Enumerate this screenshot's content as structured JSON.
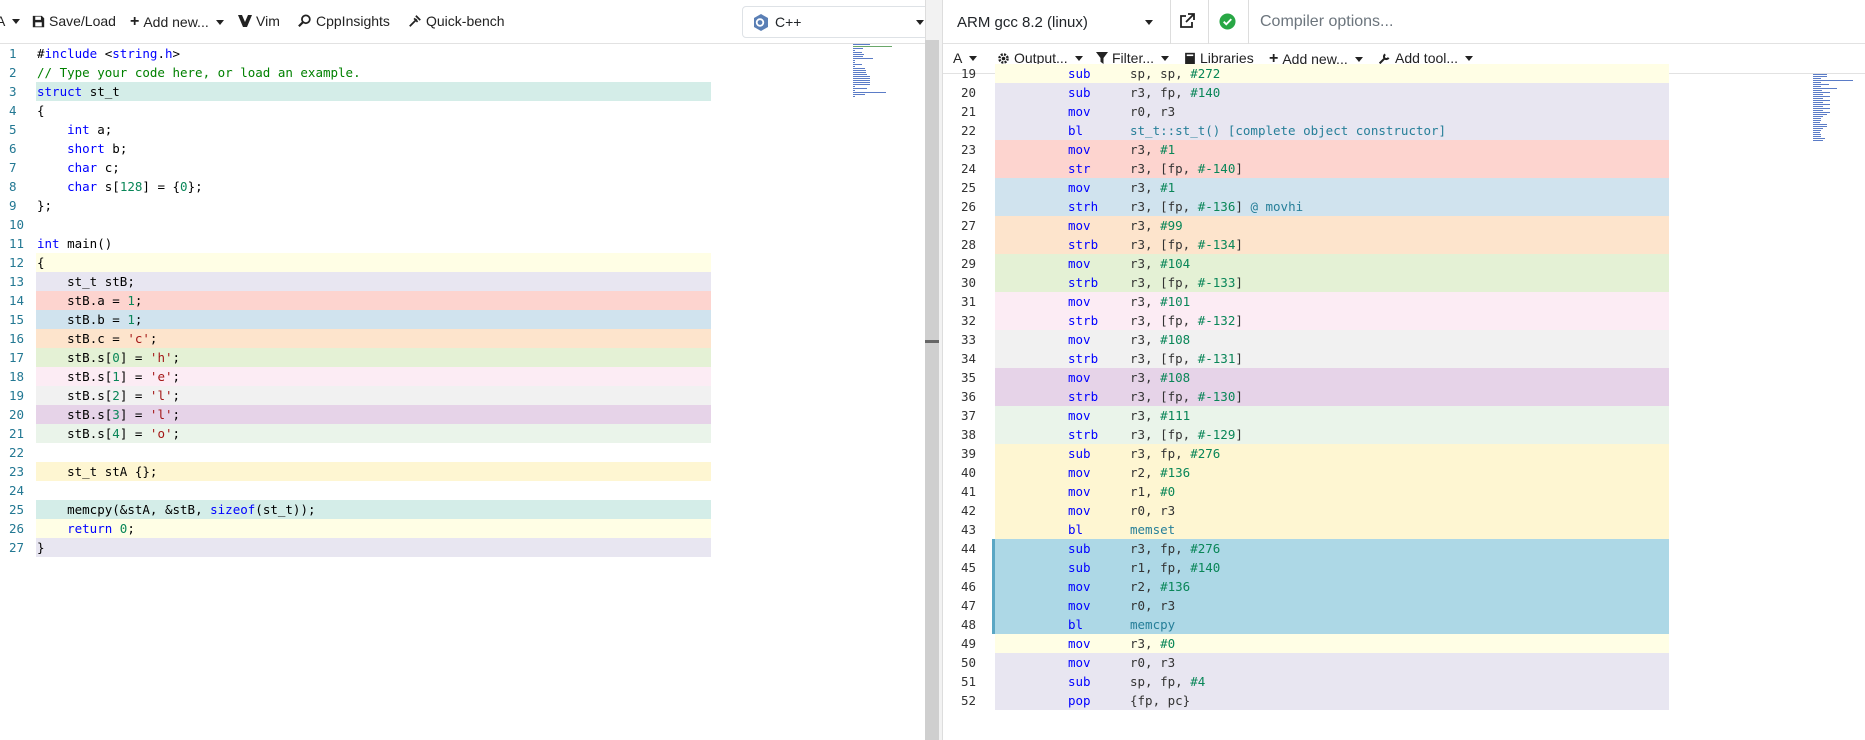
{
  "editor": {
    "toolbar": {
      "font_label": "A",
      "save_load": "Save/Load",
      "add_new": "Add new...",
      "vim": "Vim",
      "cppinsights": "CppInsights",
      "quickbench": "Quick-bench",
      "language": "C++"
    },
    "lines": [
      {
        "n": "1",
        "text": "#include <string.h>",
        "bg": ""
      },
      {
        "n": "2",
        "text": "// Type your code here, or load an example.",
        "bg": ""
      },
      {
        "n": "3",
        "text": "struct st_t",
        "bg": "#d4ede8"
      },
      {
        "n": "4",
        "text": "{",
        "bg": ""
      },
      {
        "n": "5",
        "text": "    int a;",
        "bg": ""
      },
      {
        "n": "6",
        "text": "    short b;",
        "bg": ""
      },
      {
        "n": "7",
        "text": "    char c;",
        "bg": ""
      },
      {
        "n": "8",
        "text": "    char s[128] = {0};",
        "bg": ""
      },
      {
        "n": "9",
        "text": "};",
        "bg": ""
      },
      {
        "n": "10",
        "text": "",
        "bg": ""
      },
      {
        "n": "11",
        "text": "int main()",
        "bg": ""
      },
      {
        "n": "12",
        "text": "{",
        "bg": "#fffee5"
      },
      {
        "n": "13",
        "text": "    st_t stB;",
        "bg": "#e8e6f1"
      },
      {
        "n": "14",
        "text": "    stB.a = 1;",
        "bg": "#fdd4cf"
      },
      {
        "n": "15",
        "text": "    stB.b = 1;",
        "bg": "#d0e3ee"
      },
      {
        "n": "16",
        "text": "    stB.c = 'c';",
        "bg": "#fde4cc"
      },
      {
        "n": "17",
        "text": "    stB.s[0] = 'h';",
        "bg": "#e4f1d5"
      },
      {
        "n": "18",
        "text": "    stB.s[1] = 'e';",
        "bg": "#fcecf4"
      },
      {
        "n": "19",
        "text": "    stB.s[2] = 'l';",
        "bg": "#f1f1f1"
      },
      {
        "n": "20",
        "text": "    stB.s[3] = 'l';",
        "bg": "#e6d3e8"
      },
      {
        "n": "21",
        "text": "    stB.s[4] = 'o';",
        "bg": "#eaf4ea"
      },
      {
        "n": "22",
        "text": "",
        "bg": ""
      },
      {
        "n": "23",
        "text": "    st_t stA {};",
        "bg": "#fef6d2"
      },
      {
        "n": "24",
        "text": "",
        "bg": ""
      },
      {
        "n": "25",
        "text": "    memcpy(&stA, &stB, sizeof(st_t));",
        "bg": "#d4ede8"
      },
      {
        "n": "26",
        "text": "    return 0;",
        "bg": "#fffee5"
      },
      {
        "n": "27",
        "text": "}",
        "bg": "#e8e6f1"
      }
    ]
  },
  "compiler": {
    "name": "ARM gcc 8.2 (linux)",
    "options_placeholder": "Compiler options...",
    "toolbar": {
      "font_label": "A",
      "output": "Output...",
      "filter": "Filter...",
      "libraries": "Libraries",
      "add_new": "Add new...",
      "add_tool": "Add tool..."
    },
    "asm_lines": [
      {
        "n": "19",
        "mn": "sub",
        "ops": "sp, sp, #272",
        "bg": "#fffee5"
      },
      {
        "n": "20",
        "mn": "sub",
        "ops": "r3, fp, #140",
        "bg": "#e8e6f1"
      },
      {
        "n": "21",
        "mn": "mov",
        "ops": "r0, r3",
        "bg": "#e8e6f1"
      },
      {
        "n": "22",
        "mn": "bl",
        "ops": "st_t::st_t() [complete object constructor]",
        "bg": "#e8e6f1"
      },
      {
        "n": "23",
        "mn": "mov",
        "ops": "r3, #1",
        "bg": "#fdd4cf"
      },
      {
        "n": "24",
        "mn": "str",
        "ops": "r3, [fp, #-140]",
        "bg": "#fdd4cf"
      },
      {
        "n": "25",
        "mn": "mov",
        "ops": "r3, #1",
        "bg": "#d0e3ee"
      },
      {
        "n": "26",
        "mn": "strh",
        "ops": "r3, [fp, #-136] @ movhi",
        "bg": "#d0e3ee"
      },
      {
        "n": "27",
        "mn": "mov",
        "ops": "r3, #99",
        "bg": "#fde4cc"
      },
      {
        "n": "28",
        "mn": "strb",
        "ops": "r3, [fp, #-134]",
        "bg": "#fde4cc"
      },
      {
        "n": "29",
        "mn": "mov",
        "ops": "r3, #104",
        "bg": "#e4f1d5"
      },
      {
        "n": "30",
        "mn": "strb",
        "ops": "r3, [fp, #-133]",
        "bg": "#e4f1d5"
      },
      {
        "n": "31",
        "mn": "mov",
        "ops": "r3, #101",
        "bg": "#fcecf4"
      },
      {
        "n": "32",
        "mn": "strb",
        "ops": "r3, [fp, #-132]",
        "bg": "#fcecf4"
      },
      {
        "n": "33",
        "mn": "mov",
        "ops": "r3, #108",
        "bg": "#f1f1f1"
      },
      {
        "n": "34",
        "mn": "strb",
        "ops": "r3, [fp, #-131]",
        "bg": "#f1f1f1"
      },
      {
        "n": "35",
        "mn": "mov",
        "ops": "r3, #108",
        "bg": "#e6d3e8"
      },
      {
        "n": "36",
        "mn": "strb",
        "ops": "r3, [fp, #-130]",
        "bg": "#e6d3e8"
      },
      {
        "n": "37",
        "mn": "mov",
        "ops": "r3, #111",
        "bg": "#eaf4ea"
      },
      {
        "n": "38",
        "mn": "strb",
        "ops": "r3, [fp, #-129]",
        "bg": "#eaf4ea"
      },
      {
        "n": "39",
        "mn": "sub",
        "ops": "r3, fp, #276",
        "bg": "#fef6d2"
      },
      {
        "n": "40",
        "mn": "mov",
        "ops": "r2, #136",
        "bg": "#fef6d2"
      },
      {
        "n": "41",
        "mn": "mov",
        "ops": "r1, #0",
        "bg": "#fef6d2"
      },
      {
        "n": "42",
        "mn": "mov",
        "ops": "r0, r3",
        "bg": "#fef6d2"
      },
      {
        "n": "43",
        "mn": "bl",
        "ops": "memset",
        "bg": "#fef6d2"
      },
      {
        "n": "44",
        "mn": "sub",
        "ops": "r3, fp, #276",
        "bg": "#add8e6"
      },
      {
        "n": "45",
        "mn": "sub",
        "ops": "r1, fp, #140",
        "bg": "#add8e6"
      },
      {
        "n": "46",
        "mn": "mov",
        "ops": "r2, #136",
        "bg": "#add8e6"
      },
      {
        "n": "47",
        "mn": "mov",
        "ops": "r0, r3",
        "bg": "#add8e6"
      },
      {
        "n": "48",
        "mn": "bl",
        "ops": "memcpy",
        "bg": "#add8e6"
      },
      {
        "n": "49",
        "mn": "mov",
        "ops": "r3, #0",
        "bg": "#fffee5"
      },
      {
        "n": "50",
        "mn": "mov",
        "ops": "r0, r3",
        "bg": "#e8e6f1"
      },
      {
        "n": "51",
        "mn": "sub",
        "ops": "sp, fp, #4",
        "bg": "#e8e6f1"
      },
      {
        "n": "52",
        "mn": "pop",
        "ops": "{fp, pc}",
        "bg": "#e8e6f1"
      }
    ]
  },
  "colors": {
    "keyword": "#0000ff",
    "comment": "#008000",
    "string": "#a31515",
    "number": "#098658",
    "line_number": "#237893",
    "compile_ok": "#28a745"
  }
}
